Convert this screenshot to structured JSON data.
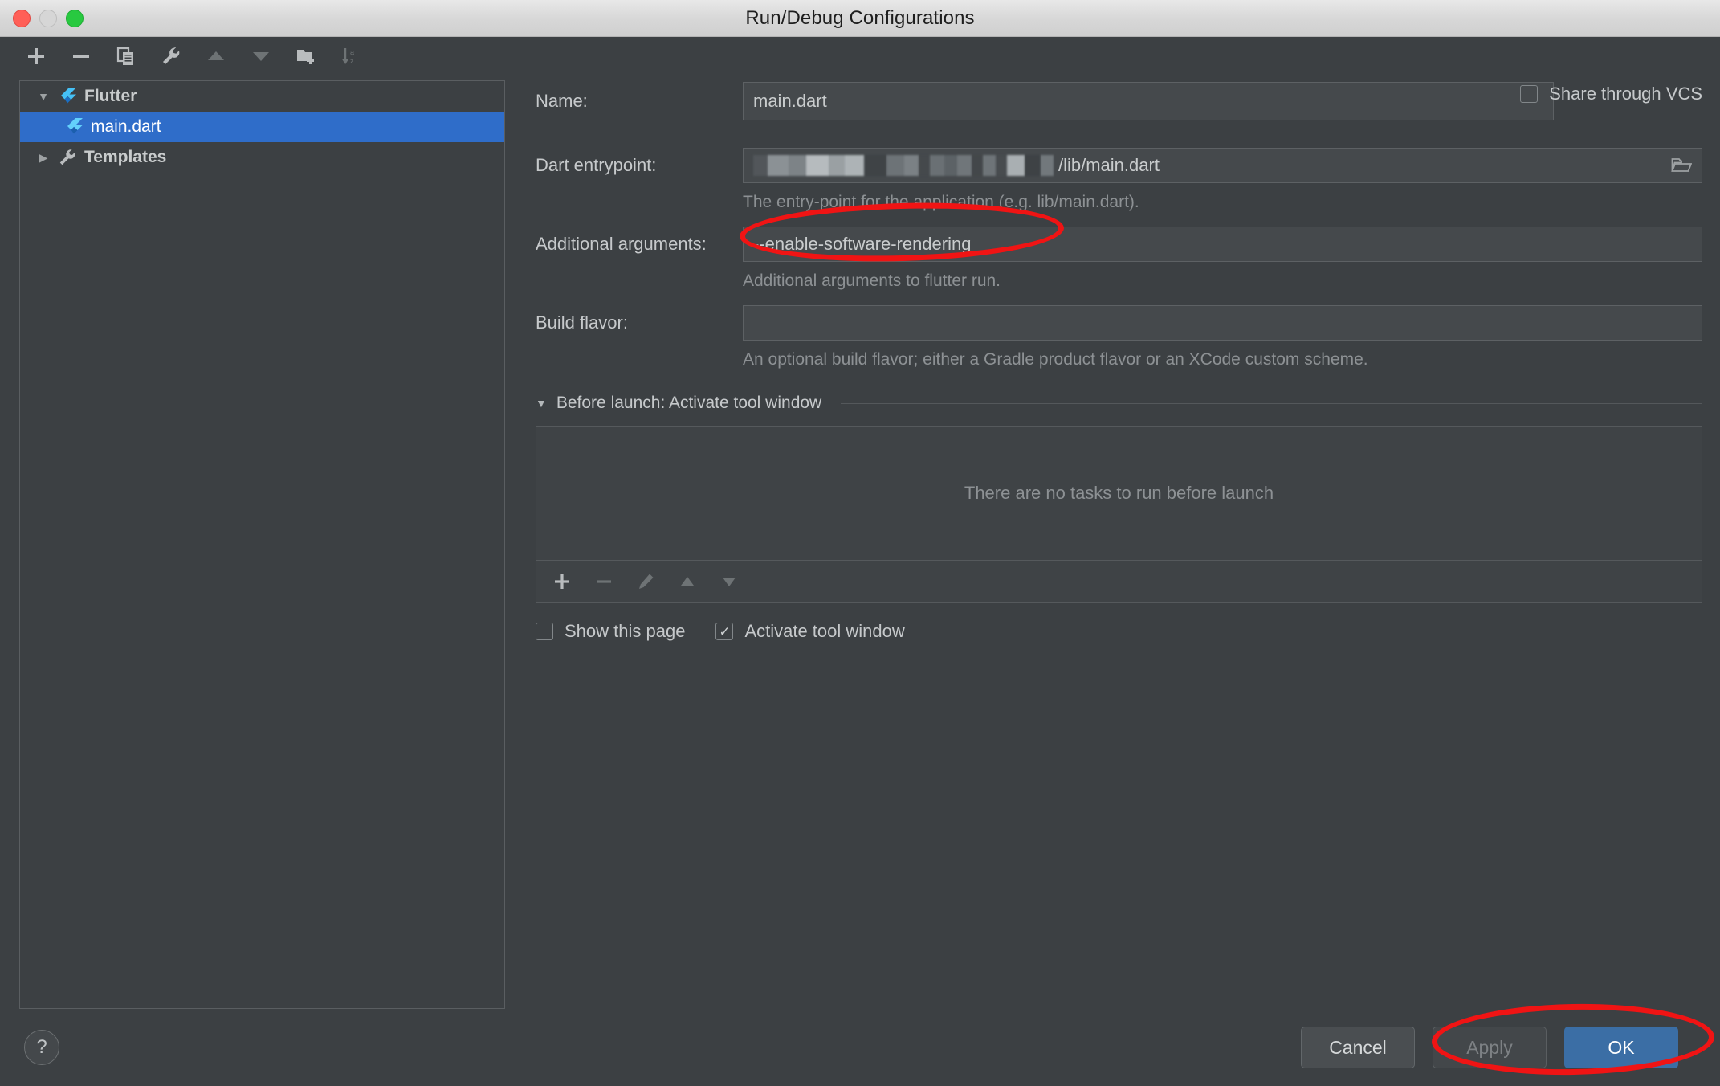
{
  "window": {
    "title": "Run/Debug Configurations",
    "traffic_lights": [
      "close",
      "minimize",
      "zoom"
    ]
  },
  "sidebar": {
    "toolbar": [
      {
        "name": "add",
        "icon": "plus-icon",
        "enabled": true
      },
      {
        "name": "remove",
        "icon": "minus-icon",
        "enabled": true
      },
      {
        "name": "copy",
        "icon": "copy-icon",
        "enabled": true
      },
      {
        "name": "edit-templates",
        "icon": "wrench-icon",
        "enabled": true
      },
      {
        "name": "move-up",
        "icon": "arrow-up-icon",
        "enabled": false
      },
      {
        "name": "move-down",
        "icon": "arrow-down-icon",
        "enabled": false
      },
      {
        "name": "new-folder",
        "icon": "folder-add-icon",
        "enabled": true
      },
      {
        "name": "sort",
        "icon": "sort-alpha-icon",
        "enabled": false
      }
    ],
    "tree": [
      {
        "label": "Flutter",
        "icon": "flutter-icon",
        "expanded": true,
        "arrow": "▼",
        "level": 0,
        "selected": false
      },
      {
        "label": "main.dart",
        "icon": "flutter-icon",
        "expanded": null,
        "arrow": "",
        "level": 1,
        "selected": true
      },
      {
        "label": "Templates",
        "icon": "wrench-icon",
        "expanded": false,
        "arrow": "▶",
        "level": 0,
        "selected": false
      }
    ],
    "help_label": "?"
  },
  "form": {
    "name": {
      "label": "Name:",
      "value": "main.dart"
    },
    "share_vcs": {
      "label": "Share through VCS",
      "checked": false,
      "check_glyph": ""
    },
    "dart_entrypoint": {
      "label": "Dart entrypoint:",
      "value": "/lib/main.dart",
      "redacted_prefix": true,
      "hint": "The entry-point for the application (e.g. lib/main.dart).",
      "browse_icon": "folder-open-icon"
    },
    "additional_arguments": {
      "label": "Additional arguments:",
      "value": "--enable-software-rendering",
      "hint": "Additional arguments to flutter run."
    },
    "build_flavor": {
      "label": "Build flavor:",
      "value": "",
      "hint": "An optional build flavor; either a Gradle product flavor or an XCode custom scheme."
    },
    "before_launch": {
      "header": "Before launch: Activate tool window",
      "caret": "▼",
      "empty_text": "There are no tasks to run before launch",
      "toolbar": [
        {
          "name": "add-task",
          "icon": "plus-icon",
          "enabled": true
        },
        {
          "name": "remove-task",
          "icon": "minus-icon",
          "enabled": false
        },
        {
          "name": "edit-task",
          "icon": "pencil-icon",
          "enabled": false
        },
        {
          "name": "task-move-up",
          "icon": "arrow-up-icon",
          "enabled": false
        },
        {
          "name": "task-move-down",
          "icon": "arrow-down-icon",
          "enabled": false
        }
      ]
    },
    "show_this_page": {
      "label": "Show this page",
      "checked": false,
      "check_glyph": ""
    },
    "activate_tool_window": {
      "label": "Activate tool window",
      "checked": true,
      "check_glyph": "✓"
    }
  },
  "footer": {
    "cancel": "Cancel",
    "apply": "Apply",
    "apply_enabled": false,
    "ok": "OK",
    "ok_default": true
  },
  "annotations": [
    {
      "name": "additional-arguments-highlight",
      "shape": "ellipse",
      "color": "#f01414"
    },
    {
      "name": "apply-ok-highlight",
      "shape": "ellipse",
      "color": "#f01414"
    }
  ],
  "colors": {
    "window_bg": "#3c4043",
    "selection_blue": "#2f6dc9",
    "accent_button": "#3b6ea5",
    "annotation_red": "#f01414",
    "flutter_blue": "#45c0f5",
    "flutter_dark_blue": "#2b7fd4"
  }
}
